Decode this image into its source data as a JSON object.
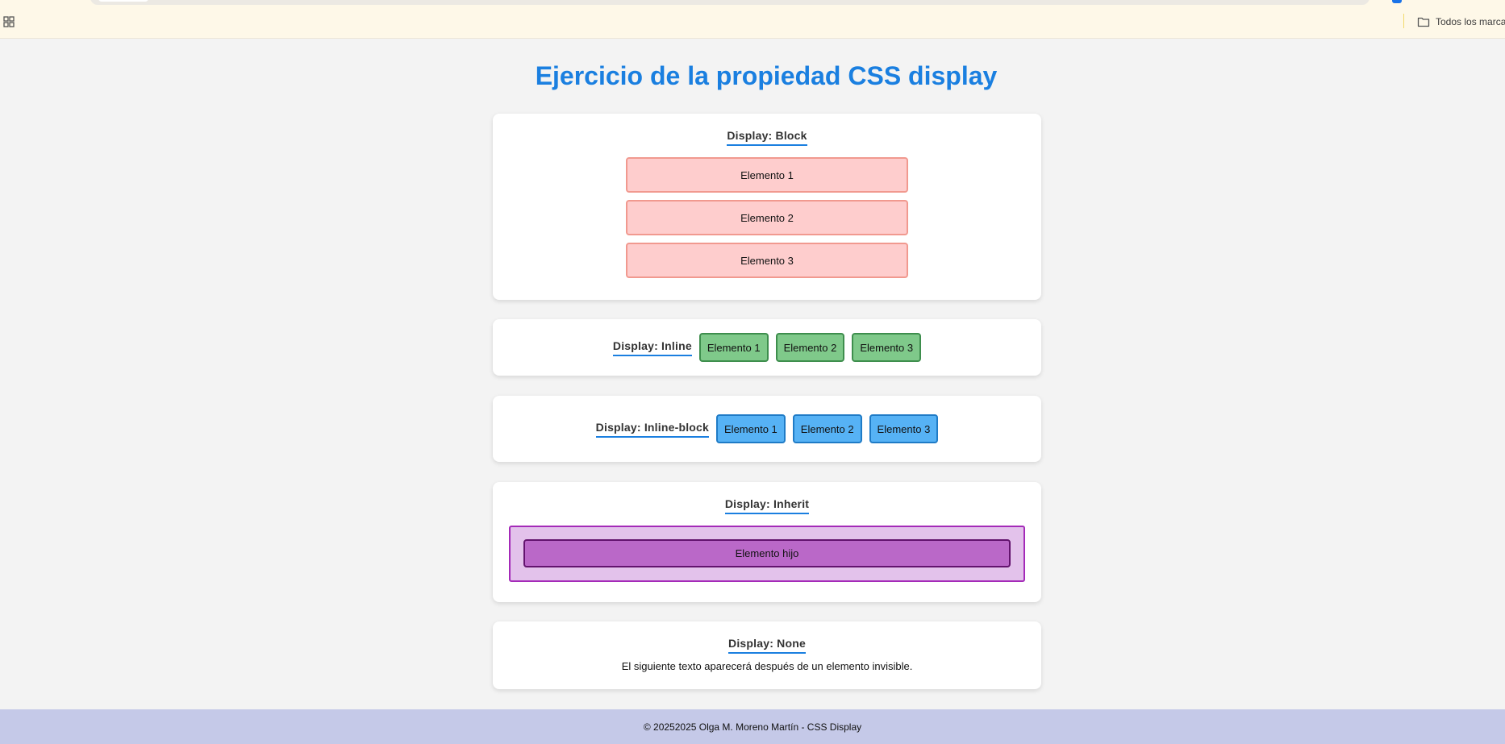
{
  "browser": {
    "bookmarks_label": "Todos los marcadores"
  },
  "page": {
    "title": "Ejercicio de la propiedad CSS display"
  },
  "block": {
    "label": "Display: Block",
    "items": [
      "Elemento 1",
      "Elemento 2",
      "Elemento 3"
    ]
  },
  "inline": {
    "label": "Display: Inline",
    "items": [
      "Elemento 1",
      "Elemento 2",
      "Elemento 3"
    ]
  },
  "inline_block": {
    "label": "Display: Inline-block",
    "items": [
      "Elemento 1",
      "Elemento 2",
      "Elemento 3"
    ]
  },
  "inherit": {
    "label": "Display: Inherit",
    "child": "Elemento hijo"
  },
  "none": {
    "label": "Display: None",
    "text": "El siguiente texto aparecerá después de un elemento invisible."
  },
  "footer": {
    "text": "© 20252025 Olga M. Moreno Martín - CSS Display"
  },
  "colors": {
    "accent": "#1a7fe0",
    "block_bg": "#fecdcd",
    "inline_bg": "#7fc98a",
    "inline_block_bg": "#56b2f5",
    "inherit_parent_bg": "#e3c2eb",
    "inherit_child_bg": "#ba68c8",
    "footer_bg": "#c5c9e8"
  },
  "icons": {
    "apps": "apps-grid-icon",
    "bookmarks_folder": "folder-icon"
  }
}
